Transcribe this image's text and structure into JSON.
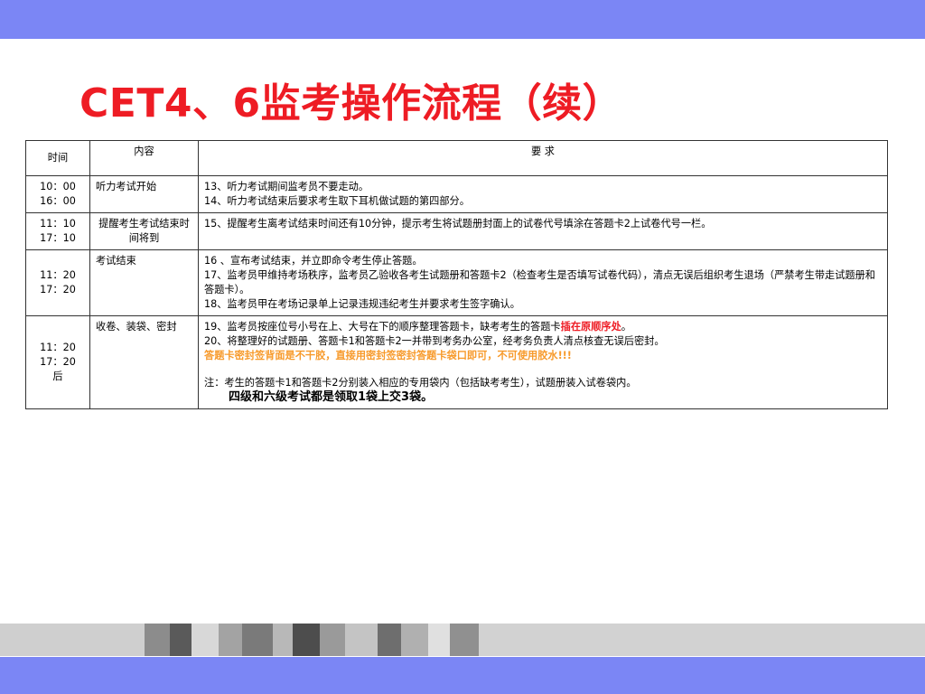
{
  "title": "CET4、6监考操作流程（续）",
  "table": {
    "headers": {
      "time": "时间",
      "content": "内容",
      "requirement": "要  求"
    },
    "rows": [
      {
        "time_1": "10：00",
        "time_2": "16：00",
        "content": "听力考试开始",
        "req_1": "13、听力考试期间监考员不要走动。",
        "req_2": "14、听力考试结束后要求考生取下耳机做试题的第四部分。"
      },
      {
        "time_1": "11：10",
        "time_2": "17：10",
        "content": "提醒考生考试结束时间将到",
        "req_1": "15、提醒考生离考试结束时间还有10分钟，提示考生将试题册封面上的试卷代号填涂在答题卡2上试卷代号一栏。"
      },
      {
        "time_1": "11：20",
        "time_2": "17：20",
        "content": "考试结束",
        "req_1": "16 、宣布考试结束，并立即命令考生停止答题。",
        "req_2": "17、监考员甲维持考场秩序，监考员乙验收各考生试题册和答题卡2（检查考生是否填写试卷代码），清点无误后组织考生退场（严禁考生带走试题册和答题卡）。",
        "req_3": "18、监考员甲在考场记录单上记录违规违纪考生并要求考生签字确认。"
      },
      {
        "time_1": "11：20",
        "time_2": "17：20",
        "time_3": "后",
        "content": "收卷、装袋、密封",
        "req_1a": "19、监考员按座位号小号在上、大号在下的顺序整理答题卡，缺考考生的答题卡",
        "req_1b": "插在原顺序处",
        "req_1c": "。",
        "req_2": "20、将整理好的试题册、答题卡1和答题卡2一并带到考务办公室，经考务负责人清点核查无误后密封。",
        "req_warn": "答题卡密封签背面是不干胶，直接用密封签密封答题卡袋口即可，不可使用胶水!!!",
        "req_note": "注：考生的答题卡1和答题卡2分别装入相应的专用袋内（包括缺考考生），试题册装入试卷袋内。",
        "req_bold": "四级和六级考试都是领取1袋上交3袋。"
      }
    ]
  },
  "colors": {
    "band": "#7b86f5",
    "title": "#ee1c24",
    "emphasis_red": "#ee1c24",
    "emphasis_orange": "#f79a2b"
  }
}
